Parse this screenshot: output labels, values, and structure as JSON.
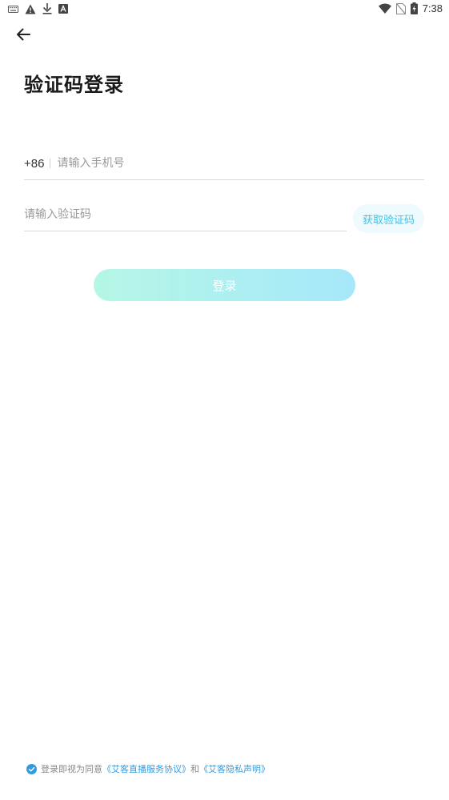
{
  "status_bar": {
    "time": "7:38",
    "icons": [
      "keyboard-icon",
      "warning-icon",
      "download-icon",
      "a-box-icon",
      "wifi-icon",
      "no-sim-icon",
      "battery-charging-icon"
    ]
  },
  "header": {
    "back_icon": "arrow-left-icon",
    "title": "验证码登录"
  },
  "form": {
    "country_code": "+86",
    "phone_placeholder": "请输入手机号",
    "phone_value": "",
    "code_placeholder": "请输入验证码",
    "code_value": "",
    "get_code_label": "获取验证码",
    "login_label": "登录"
  },
  "agreement": {
    "checked": true,
    "prefix": "登录即视为同意",
    "user_agreement": "《艾客直播服务协议》",
    "conjunction": "和",
    "privacy": "《艾客隐私声明》"
  },
  "colors": {
    "accent": "#3cc3e6",
    "link": "#2f9be0",
    "login_gradient_start": "#b5f7e5",
    "login_gradient_end": "#a6e8fa"
  }
}
